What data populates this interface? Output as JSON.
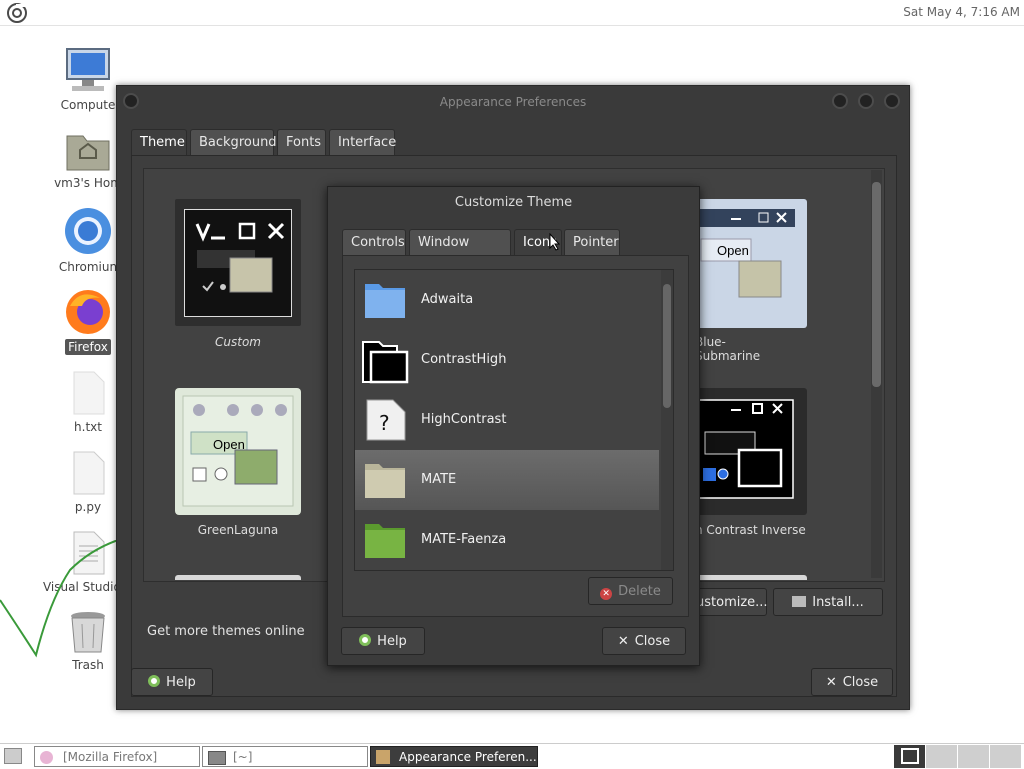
{
  "topbar": {
    "clock": "Sat May 4,  7:16 AM"
  },
  "desktop": {
    "icons": [
      {
        "label": "Compute",
        "icon": "computer-icon"
      },
      {
        "label": "vm3's Hom",
        "icon": "home-folder-icon"
      },
      {
        "label": "Chromiun",
        "icon": "chromium-icon"
      },
      {
        "label": "Firefox",
        "icon": "firefox-icon"
      },
      {
        "label": "h.txt",
        "icon": "text-file-icon"
      },
      {
        "label": "p.py",
        "icon": "text-file-icon"
      },
      {
        "label": "Visual Studio C",
        "icon": "document-icon"
      },
      {
        "label": "Trash",
        "icon": "trash-icon"
      }
    ]
  },
  "appearance": {
    "title": "Appearance Preferences",
    "tabs": [
      "Theme",
      "Background",
      "Fonts",
      "Interface"
    ],
    "themes": [
      "Custom",
      "Blue-Submarine",
      "GreenLaguna",
      "n Contrast Inverse"
    ],
    "preview_open": "Open",
    "get_more": "Get more themes online",
    "customize_label": "ustomize...",
    "install_label": "Install...",
    "help_label": "Help",
    "close_label": "Close"
  },
  "customize": {
    "title": "Customize Theme",
    "tabs": [
      "Controls",
      "Window Border",
      "Icons",
      "Pointer"
    ],
    "icons": [
      {
        "name": "Adwaita",
        "icon": "blue-folder-icon"
      },
      {
        "name": "ContrastHigh",
        "icon": "black-folder-icon"
      },
      {
        "name": "HighContrast",
        "icon": "unknown-file-icon"
      },
      {
        "name": "MATE",
        "icon": "beige-folder-icon"
      },
      {
        "name": "MATE-Faenza",
        "icon": "green-folder-icon"
      }
    ],
    "help_icon_glyph": "?",
    "delete_label": "Delete",
    "help_label": "Help",
    "close_label": "Close"
  },
  "taskbar": {
    "tasks": [
      "[Mozilla Firefox]",
      "[~]",
      "Appearance Preferen..."
    ]
  },
  "colors": {
    "window_bg": "#3a3a3a",
    "selection": "#606060",
    "accent_green": "#6a9e3a"
  }
}
